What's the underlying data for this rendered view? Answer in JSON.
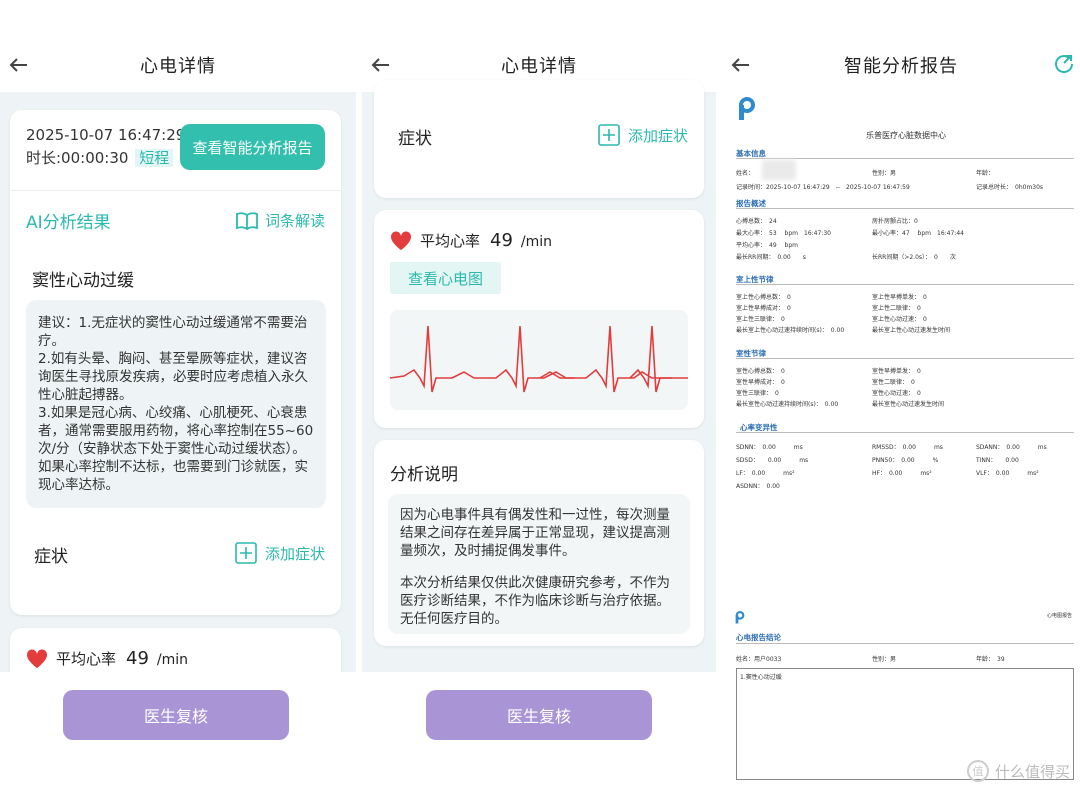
{
  "panel1": {
    "title": "心电详情",
    "datetime": "2025-10-07 16:47:29",
    "duration": "时长:00:00:30",
    "duration_tag": "短程",
    "report_button": "查看智能分析报告",
    "ai_title": "AI分析结果",
    "glossary": "词条解读",
    "diagnosis": "窦性心动过缓",
    "advice": "建议：1.无症状的窦性心动过缓通常不需要治疗。\n2.如有头晕、胸闷、甚至晕厥等症状，建议咨询医生寻找原发疾病，必要时应考虑植入永久性心脏起搏器。\n3.如果是冠心病、心绞痛、心肌梗死、心衰患者，通常需要服用药物，将心率控制在55~60次/分（安静状态下处于窦性心动过缓状态）。如果心率控制不达标，也需要到门诊就医，实现心率达标。",
    "symptom": "症状",
    "add_symptom": "添加症状",
    "hr_label": "平均心率",
    "hr_value": "49",
    "hr_unit": "/min",
    "review_button": "医生复核"
  },
  "panel2": {
    "title": "心电详情",
    "symptom": "症状",
    "add_symptom": "添加症状",
    "hr_label": "平均心率",
    "hr_value": "49",
    "hr_unit": "/min",
    "ecg_button": "查看心电图",
    "analysis_title": "分析说明",
    "analysis_p1": "因为心电事件具有偶发性和一过性，每次测量结果之间存在差异属于正常显现，建议提高测量频次，及时捕捉偶发事件。",
    "analysis_p2": "本次分析结果仅供此次健康研究参考，不作为医疗诊断结果，不作为临床诊断与治疗依据。无任何医疗目的。",
    "review_button": "医生复核"
  },
  "panel3": {
    "title": "智能分析报告",
    "center": "乐普医疗心脏数据中心",
    "basic": "基本信息",
    "name_label": "姓名：",
    "gender": "性别：男",
    "age": "年龄：",
    "record_time": "记录时间：2025-10-07 16:47:29　--　2025-10-07 16:47:59",
    "record_total": "记录总时长：　0h0m30s",
    "overview": "报告概述",
    "ov_beats": "心搏总数：　24",
    "ov_ratio": "房扑房颤占比：0",
    "ov_max": "最大心率：　53　 bpm　16:47:30",
    "ov_min": "最小心率：47　 bpm　16:47:44",
    "ov_avg": "平均心率：　49　 bpm",
    "ov_rr": "最长RR间期：　0.00　　s",
    "ov_rr2": "长RR间期（>2.0s）：　0　　次",
    "sv": "室上性节律",
    "sv1": "室上性心搏总数：　0",
    "sv2": "室上性早搏单发：　0",
    "sv3": "室上性早搏成对：　0",
    "sv4": "室上性二联律：　0",
    "sv5": "室上性三联律：　0",
    "sv6": "室上性心动过速：　0",
    "sv7": "最长室上性心动过速持续时间(s)：　0.00",
    "sv8": "最长室上性心动过速发生时间",
    "v": "室性节律",
    "v1": "室性心搏总数：　0",
    "v2": "室性早搏单发：　0",
    "v3": "室性早搏成对：　0",
    "v4": "室性二联律：　0",
    "v5": "室性三联律：　0",
    "v6": "室性心动过速：　0",
    "v7": "最长室性心动过速持续时间(s)：　0.00",
    "v8": "最长室性心动过速发生时间",
    "hrv": "心率变异性",
    "h1": "SDNN：　0.00　　　ms",
    "h2": "RMSSD：　0.00　　　ms",
    "h3": "SDANN：　0.00　　　ms",
    "h4": "SDSD：　　0.00　　　ms",
    "h5": "PNN50：　0.00　　　%",
    "h6": "TINN：　　0.00",
    "h7": "LF：　0.00　　　ms²",
    "h8": "HF：　0.00　　　ms²",
    "h9": "VLF：　0.00　　　ms²",
    "h10": "ASDNN：　0.00",
    "p2_corner": "心电图报告",
    "conclusion": "心电报告结论",
    "c_name": "姓名：用户0033",
    "c_gender": "性别：男",
    "c_age": "年龄：　39",
    "c_result": "1.窦性心动过缓",
    "watermark": "什么值得买"
  },
  "colors": {
    "teal": "#2cb9ad",
    "purple": "#a994d6",
    "ecg": "#e23c3c",
    "report_blue": "#2f6fb4"
  }
}
